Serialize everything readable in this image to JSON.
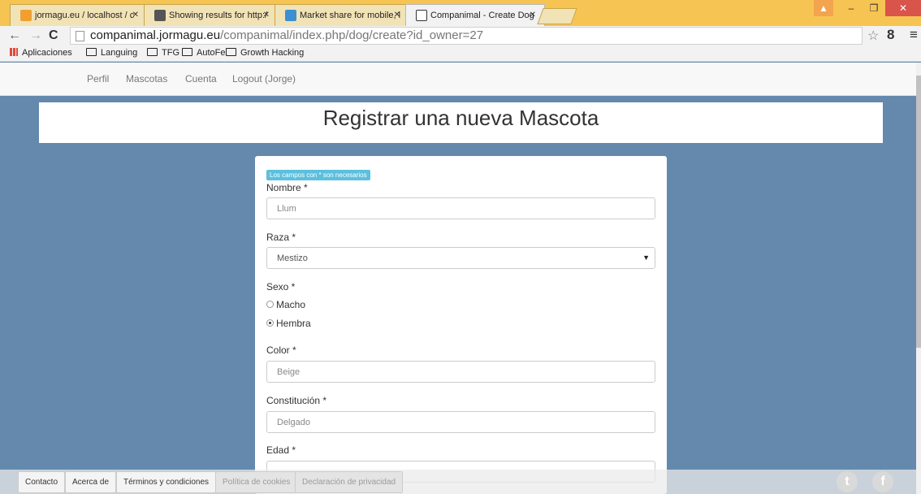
{
  "browser": {
    "tabs": [
      {
        "title": "jormagu.eu / localhost / c",
        "active": false,
        "icon": "phpmyadmin-icon"
      },
      {
        "title": "Showing results for http:/",
        "active": false,
        "icon": "search-results-icon"
      },
      {
        "title": "Market share for mobile, l",
        "active": false,
        "icon": "chart-icon"
      },
      {
        "title": "Companimal - Create Dog",
        "active": true,
        "icon": "paw-icon"
      }
    ],
    "url_host": "companimal.jormagu.eu",
    "url_path": "/companimal/index.php/dog/create?id_owner=27",
    "bookmarks": [
      "Aplicaciones",
      "Languing",
      "TFG",
      "AutoFe",
      "Growth Hacking"
    ]
  },
  "nav": {
    "items": [
      "Perfil",
      "Mascotas",
      "Cuenta",
      "Logout (Jorge)"
    ]
  },
  "page": {
    "title": "Registrar una nueva Mascota"
  },
  "form": {
    "required_note": "Los campos con * son necesarios",
    "name_label": "Nombre *",
    "name_value": "Llum",
    "breed_label": "Raza *",
    "breed_value": "Mestizo",
    "sex_label": "Sexo *",
    "sex_options": [
      "Macho",
      "Hembra"
    ],
    "sex_selected": "Hembra",
    "color_label": "Color *",
    "color_value": "Beige",
    "build_label": "Constitución *",
    "build_value": "Delgado",
    "age_label": "Edad *"
  },
  "footer": {
    "buttons": [
      "Contacto",
      "Acerca de",
      "Términos y condiciones",
      "Política de cookies",
      "Declaración de privacidad"
    ]
  },
  "colors": {
    "page_bg": "#6489ad",
    "note_bg": "#5bc0de",
    "tabbar_bg": "#f6c452"
  }
}
